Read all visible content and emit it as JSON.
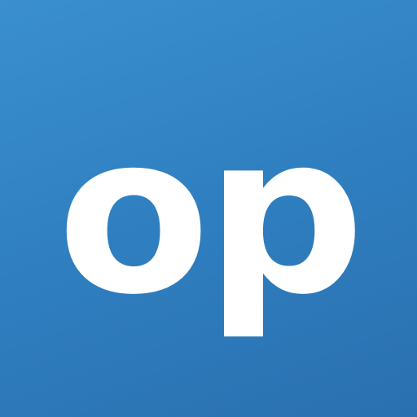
{
  "logo": {
    "text": "op",
    "text_color": "#ffffff",
    "background_color": "#2f80c1"
  }
}
